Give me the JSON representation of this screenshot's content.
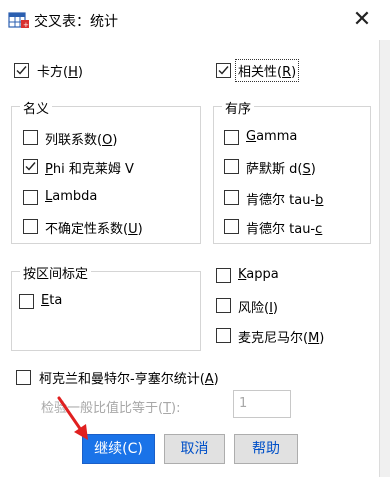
{
  "window": {
    "title": "交叉表：统计",
    "close_symbol": "✕"
  },
  "top_options": {
    "chi_square": {
      "label_pre": "卡方(",
      "key": "H",
      "label_post": ")",
      "checked": true
    },
    "correlation": {
      "label_pre": "相关性(",
      "key": "R",
      "label_post": ")",
      "checked": true
    }
  },
  "nominal": {
    "title": "名义",
    "items": [
      {
        "pre": "列联系数(",
        "key": "O",
        "post": ")",
        "checked": false
      },
      {
        "pre": "",
        "key": "P",
        "post": "hi 和克莱姆 V",
        "checked": true
      },
      {
        "pre": "",
        "key": "L",
        "post": "ambda",
        "checked": false
      },
      {
        "pre": "不确定性系数(",
        "key": "U",
        "post": ")",
        "checked": false
      }
    ]
  },
  "ordinal": {
    "title": "有序",
    "items": [
      {
        "pre": "",
        "key": "G",
        "post": "amma",
        "checked": false
      },
      {
        "pre": "萨默斯 d(",
        "key": "S",
        "post": ")",
        "checked": false
      },
      {
        "pre": "肯德尔 tau-",
        "key": "b",
        "post": "",
        "checked": false
      },
      {
        "pre": "肯德尔 tau-",
        "key": "c",
        "post": "",
        "checked": false
      }
    ]
  },
  "interval": {
    "title": "按区间标定",
    "eta": {
      "pre": "",
      "key": "E",
      "post": "ta",
      "checked": false
    }
  },
  "other": {
    "kappa": {
      "pre": "",
      "key": "K",
      "post": "appa",
      "checked": false
    },
    "risk": {
      "pre": "风险(",
      "key": "I",
      "post": ")",
      "checked": false
    },
    "mcnemar": {
      "pre": "麦克尼马尔(",
      "key": "M",
      "post": ")",
      "checked": false
    }
  },
  "cmh": {
    "pre": "柯克兰和曼特尔-亨塞尔统计(",
    "key": "A",
    "post": ")",
    "checked": false,
    "ratio_label": {
      "pre": "检验一般比值比等于(",
      "key": "T",
      "post": "):"
    },
    "ratio_value": "1"
  },
  "buttons": {
    "continue": "继续(C)",
    "cancel": "取消",
    "help": "帮助"
  },
  "colors": {
    "primary_button": "#1a73e8",
    "link_text": "#0050c8",
    "annotation_arrow": "#e02020"
  }
}
